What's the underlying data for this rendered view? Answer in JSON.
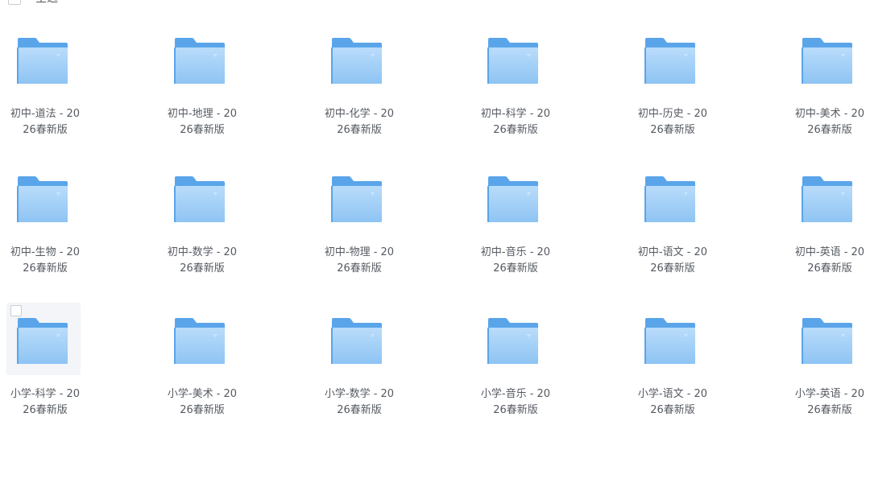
{
  "header": {
    "select_all_label": "全选"
  },
  "colors": {
    "folder_back": "#5aa5ea",
    "folder_front_top": "#b9dcfb",
    "folder_front_bottom": "#8ec4f3",
    "text": "#555a61"
  },
  "folders": [
    {
      "line1": "初中-道法 - 20",
      "line2": "26春新版"
    },
    {
      "line1": "初中-地理 - 20",
      "line2": "26春新版"
    },
    {
      "line1": "初中-化学 - 20",
      "line2": "26春新版"
    },
    {
      "line1": "初中-科学 - 20",
      "line2": "26春新版"
    },
    {
      "line1": "初中-历史 - 20",
      "line2": "26春新版"
    },
    {
      "line1": "初中-美术 - 20",
      "line2": "26春新版"
    },
    {
      "line1": "初中-生物 - 20",
      "line2": "26春新版"
    },
    {
      "line1": "初中-数学 - 20",
      "line2": "26春新版"
    },
    {
      "line1": "初中-物理 - 20",
      "line2": "26春新版"
    },
    {
      "line1": "初中-音乐 - 20",
      "line2": "26春新版"
    },
    {
      "line1": "初中-语文 - 20",
      "line2": "26春新版"
    },
    {
      "line1": "初中-英语 - 20",
      "line2": "26春新版"
    },
    {
      "line1": "小学-科学 - 20",
      "line2": "26春新版"
    },
    {
      "line1": "小学-美术 - 20",
      "line2": "26春新版"
    },
    {
      "line1": "小学-数学 - 20",
      "line2": "26春新版"
    },
    {
      "line1": "小学-音乐 - 20",
      "line2": "26春新版"
    },
    {
      "line1": "小学-语文 - 20",
      "line2": "26春新版"
    },
    {
      "line1": "小学-英语 - 20",
      "line2": "26春新版"
    }
  ]
}
